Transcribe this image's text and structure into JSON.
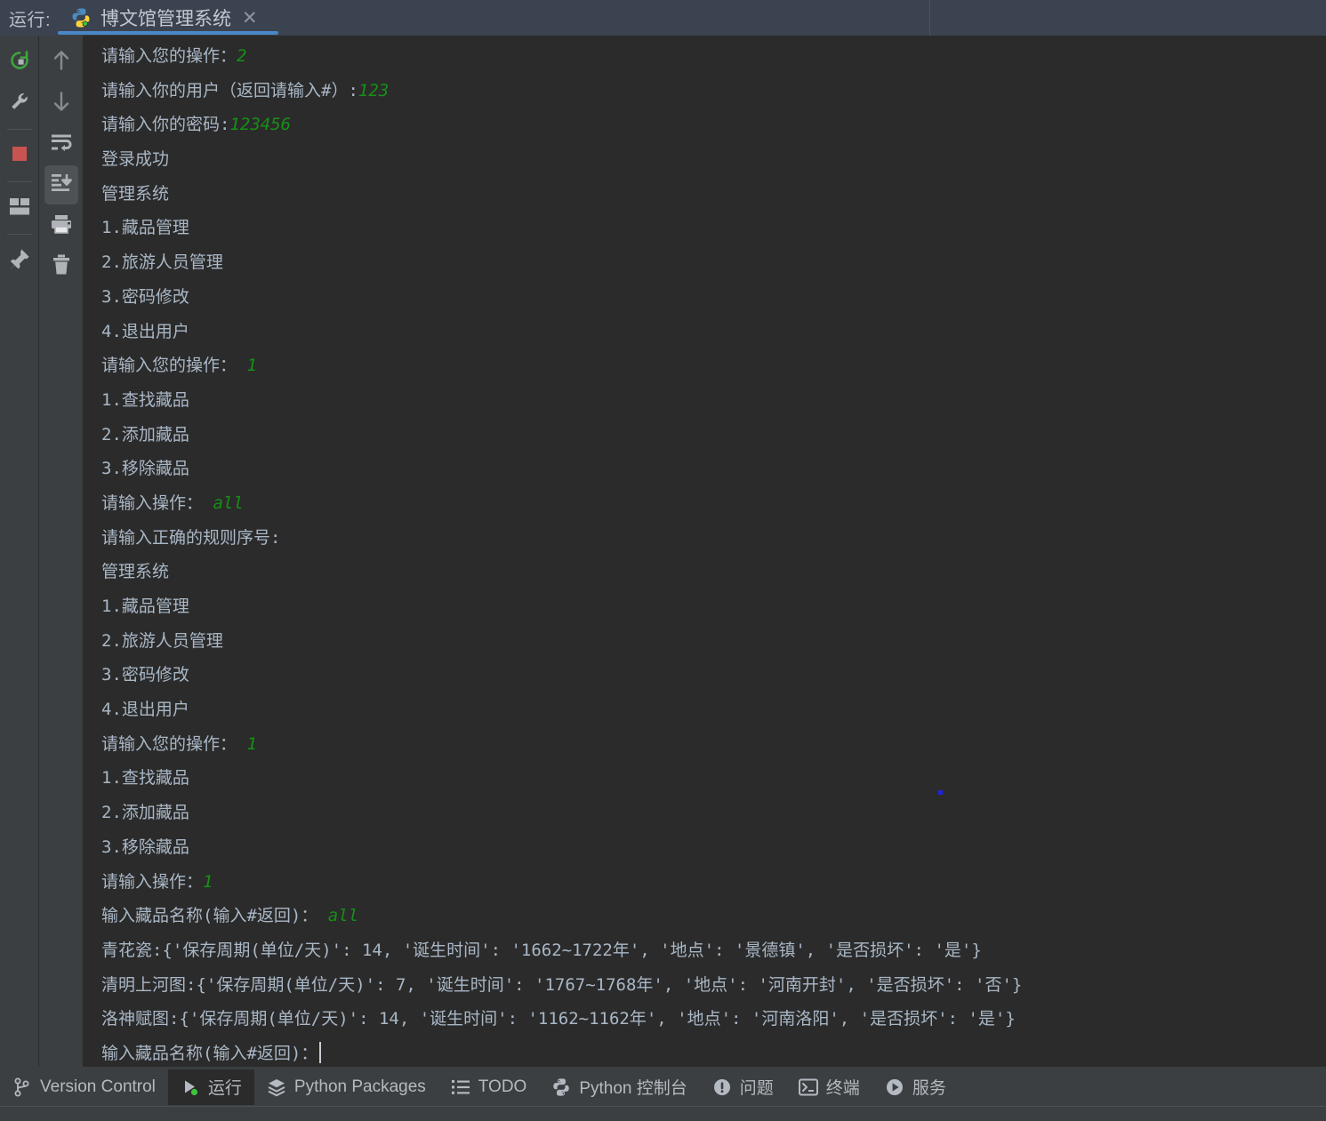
{
  "topbar": {
    "run_label": "运行:",
    "tab": {
      "title": "博文馆管理系统",
      "icon": "python-icon",
      "close": "✕"
    }
  },
  "toolbar_left": {
    "items": [
      {
        "name": "rerun-icon",
        "label": "重新运行"
      },
      {
        "name": "wrench-settings-icon",
        "label": "修改运行配置"
      },
      {
        "name": "stop-icon",
        "label": "停止"
      },
      {
        "name": "layout-icon",
        "label": "布局设置"
      },
      {
        "name": "pin-icon",
        "label": "固定标签页"
      }
    ]
  },
  "toolbar_right": {
    "items": [
      {
        "name": "arrow-up-icon",
        "label": "上一次出现"
      },
      {
        "name": "arrow-down-icon",
        "label": "下一次出现"
      },
      {
        "name": "soft-wrap-icon",
        "label": "软换行"
      },
      {
        "name": "scroll-to-end-icon",
        "label": "滚动到末尾"
      },
      {
        "name": "print-icon",
        "label": "打印"
      },
      {
        "name": "trash-icon",
        "label": "清除全部"
      }
    ]
  },
  "console": {
    "lines": [
      {
        "text": "请输入您的操作：",
        "input": "2"
      },
      {
        "text": "请输入你的用户（返回请输入#）:",
        "input": "123"
      },
      {
        "text": "请输入你的密码:",
        "input": "123456"
      },
      {
        "text": "登录成功",
        "input": ""
      },
      {
        "text": "管理系统",
        "input": ""
      },
      {
        "text": "1.藏品管理",
        "input": ""
      },
      {
        "text": "2.旅游人员管理",
        "input": ""
      },
      {
        "text": "3.密码修改",
        "input": ""
      },
      {
        "text": "4.退出用户",
        "input": ""
      },
      {
        "text": "请输入您的操作： ",
        "input": "1"
      },
      {
        "text": "1.查找藏品",
        "input": ""
      },
      {
        "text": "2.添加藏品",
        "input": ""
      },
      {
        "text": "3.移除藏品",
        "input": ""
      },
      {
        "text": "请输入操作： ",
        "input": "all"
      },
      {
        "text": "请输入正确的规则序号:",
        "input": ""
      },
      {
        "text": "管理系统",
        "input": ""
      },
      {
        "text": "1.藏品管理",
        "input": ""
      },
      {
        "text": "2.旅游人员管理",
        "input": ""
      },
      {
        "text": "3.密码修改",
        "input": ""
      },
      {
        "text": "4.退出用户",
        "input": ""
      },
      {
        "text": "请输入您的操作： ",
        "input": "1"
      },
      {
        "text": "1.查找藏品",
        "input": ""
      },
      {
        "text": "2.添加藏品",
        "input": ""
      },
      {
        "text": "3.移除藏品",
        "input": ""
      },
      {
        "text": "请输入操作：",
        "input": "1"
      },
      {
        "text": "输入藏品名称(输入#返回)： ",
        "input": "all"
      },
      {
        "text": "青花瓷:{'保存周期(单位/天)': 14, '诞生时间': '1662~1722年', '地点': '景德镇', '是否损坏': '是'}",
        "input": ""
      },
      {
        "text": "清明上河图:{'保存周期(单位/天)': 7, '诞生时间': '1767~1768年', '地点': '河南开封', '是否损坏': '否'}",
        "input": ""
      },
      {
        "text": "洛神赋图:{'保存周期(单位/天)': 14, '诞生时间': '1162~1162年', '地点': '河南洛阳', '是否损坏': '是'}",
        "input": ""
      },
      {
        "text": "输入藏品名称(输入#返回)：",
        "input": "",
        "caret": true
      }
    ],
    "colors": {
      "background": "#2b2b2b",
      "text": "#a9b7c6",
      "user_input": "#169016"
    }
  },
  "statusbar": {
    "items": [
      {
        "label": "Version Control",
        "icon": "branch-icon",
        "active": false
      },
      {
        "label": "运行",
        "icon": "run-play-icon",
        "active": true
      },
      {
        "label": "Python Packages",
        "icon": "layers-icon",
        "active": false
      },
      {
        "label": "TODO",
        "icon": "list-icon",
        "active": false
      },
      {
        "label": "Python 控制台",
        "icon": "python-icon",
        "active": false
      },
      {
        "label": "问题",
        "icon": "warning-icon",
        "active": false
      },
      {
        "label": "终端",
        "icon": "terminal-icon",
        "active": false
      },
      {
        "label": "服务",
        "icon": "services-play-icon",
        "active": false
      }
    ]
  }
}
